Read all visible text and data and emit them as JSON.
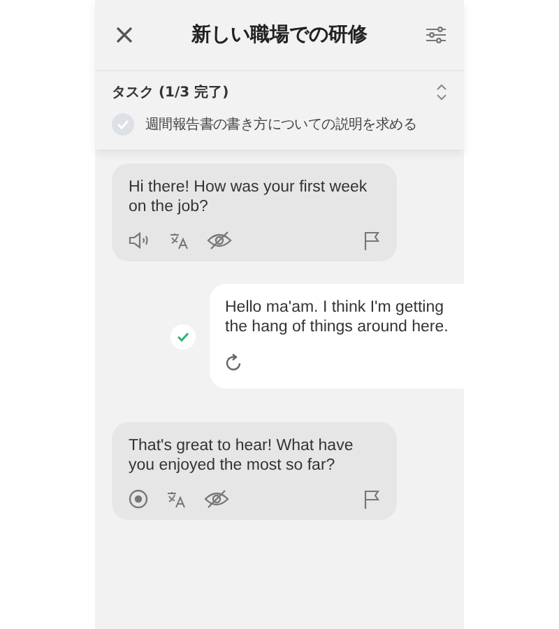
{
  "header": {
    "title": "新しい職場での研修"
  },
  "tasks": {
    "heading": "タスク (1/3 完了)",
    "items": [
      {
        "text": "週間報告書の書き方についての説明を求める",
        "done": false
      }
    ]
  },
  "messages": [
    {
      "kind": "bot",
      "text": "Hi there! How was your first week on the job?",
      "playing": false
    },
    {
      "kind": "user",
      "text": "Hello ma'am. I think I'm getting the hang of things around here.",
      "checked": true
    },
    {
      "kind": "bot",
      "text": "That's great to hear! What have you enjoyed the most so far?",
      "playing": true
    }
  ]
}
